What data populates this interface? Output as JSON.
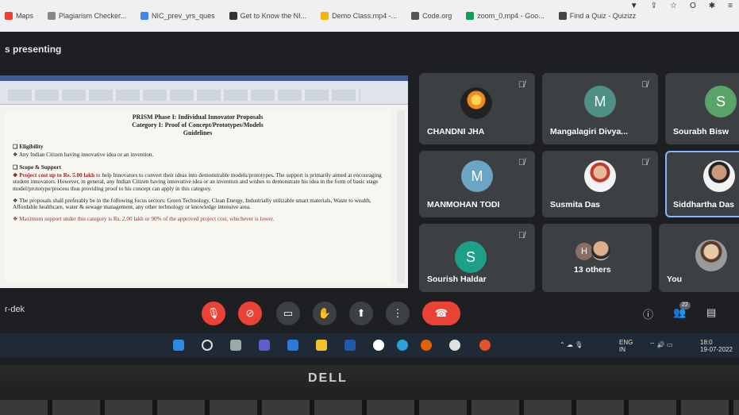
{
  "bookmarks": [
    {
      "label": "Maps",
      "color": "#e94235"
    },
    {
      "label": "Plagiarism Checker...",
      "color": "#888888"
    },
    {
      "label": "NIC_prev_yrs_ques",
      "color": "#4285f4"
    },
    {
      "label": "Get to Know the NI...",
      "color": "#333333"
    },
    {
      "label": "Demo Class.mp4 -...",
      "color": "#f4b400"
    },
    {
      "label": "Code.org",
      "color": "#555555"
    },
    {
      "label": "zoom_0.mp4 - Goo...",
      "color": "#0f9d58"
    },
    {
      "label": "Find a Quiz - Quizizz",
      "color": "#444444"
    }
  ],
  "meet": {
    "presenting_label": "s presenting",
    "self_name": "r-dek",
    "participants": [
      {
        "name": "CHANDNI JHA",
        "muted": true
      },
      {
        "name": "Mangalagiri Divya...",
        "initial": "M",
        "avatar_color": "#4e8f86",
        "muted": true
      },
      {
        "name": "Sourabh Bisw",
        "initial": "S",
        "avatar_color": "#5aa469",
        "muted": false
      },
      {
        "name": "MANMOHAN TODI",
        "initial": "M",
        "avatar_color": "#6aa6c4",
        "muted": true
      },
      {
        "name": "Susmita Das",
        "muted": true
      },
      {
        "name": "Siddhartha Das",
        "muted": false
      },
      {
        "name": "Sourish Haldar",
        "initial": "S",
        "avatar_color": "#1f9e8a",
        "muted": true
      },
      {
        "name": "13 others",
        "initial": "H"
      },
      {
        "name": "You"
      }
    ],
    "people_count": "22"
  },
  "document": {
    "title1": "PRISM Phase I: Individual Innovator Proposals",
    "title2": "Category I: Proof of Concept/Prototypes/Models",
    "title3": "Guidelines",
    "eligibility_head": "❑ Eligibility",
    "eligibility_text": "❖ Any Indian Citizen having innovative idea or an invention.",
    "scope_head": "❑ Scope & Support",
    "scope_lead": "❖ Project cost up to Rs. 5.00 lakh",
    "scope_text": " to help Innovators to convert their ideas into demonstrable models/prototypes. The support is primarily aimed at encouraging student innovators. However, in general, any Indian Citizen having innovative idea or an invention and wishes to demonstrate his idea in the form of basic stage model/prototype/process thus providing proof to his concept can apply in this category.",
    "sectors_text": "❖ The proposals shall preferably be in the following focus sectors: Green Technology, Clean Energy, Industrially utilizable smart materials, Waste to wealth, Affordable healthcare, water & sewage management, any other technology or knowledge intensive area.",
    "max_text": "❖ Maximum support under this category is Rs. 2.00 lakh or 90% of the approved project cost, whichever is lower."
  },
  "taskbar": {
    "lang_top": "ENG",
    "lang_bottom": "IN",
    "time": "18:0",
    "date": "19-07-2022"
  },
  "laptop": {
    "brand": "DELL"
  }
}
